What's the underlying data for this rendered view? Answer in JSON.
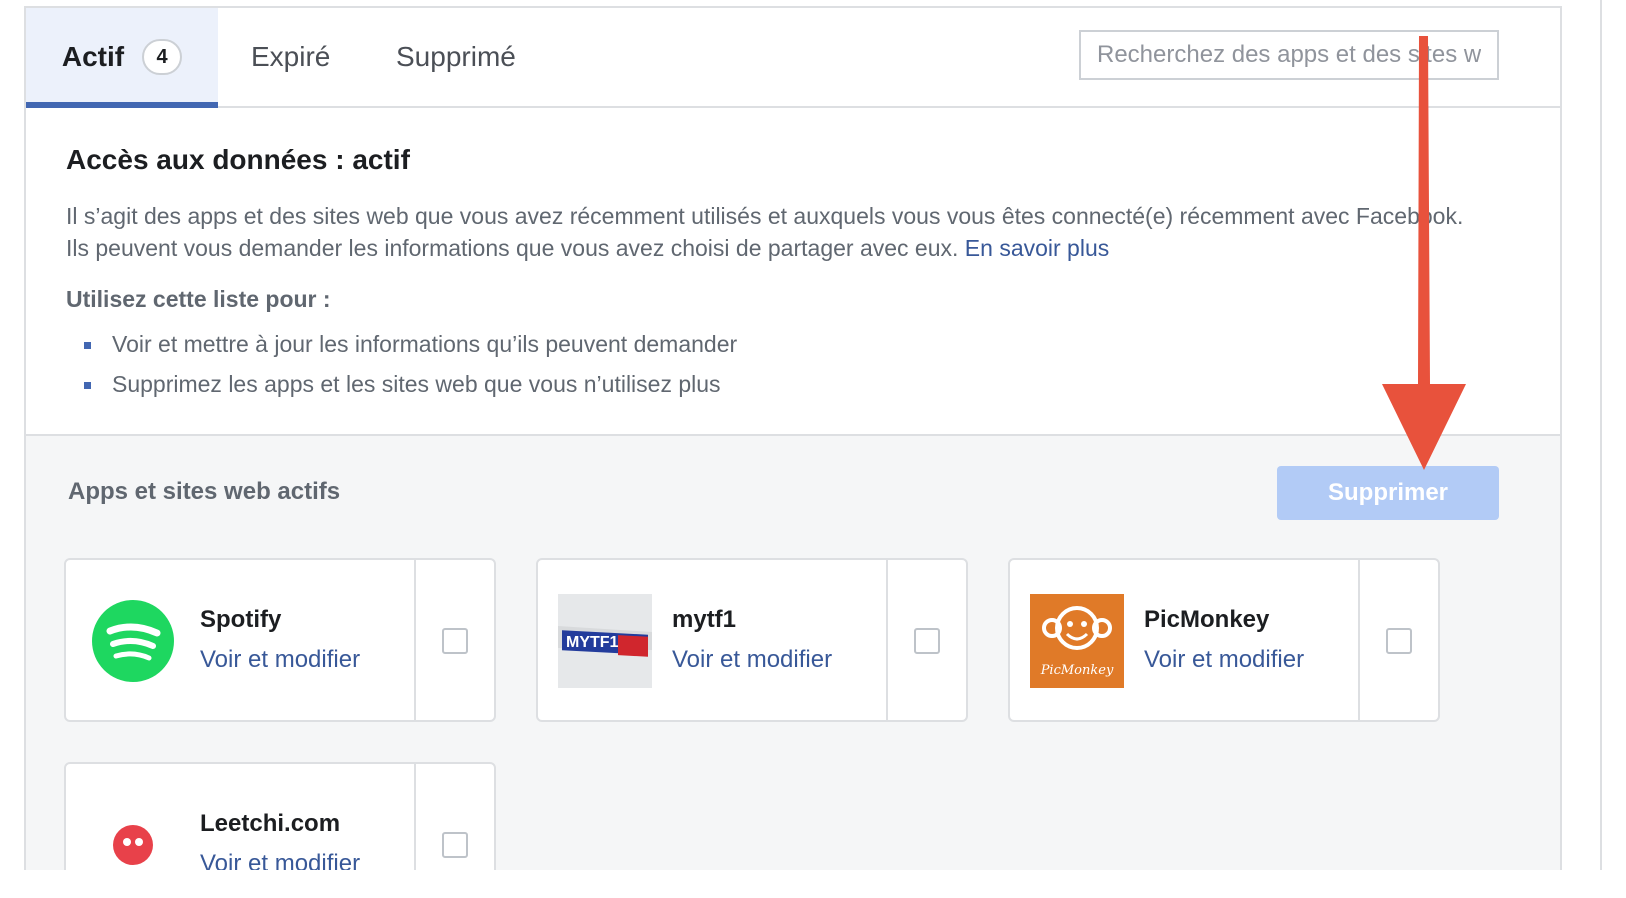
{
  "tabs": {
    "active": {
      "label": "Actif",
      "count": "4"
    },
    "expired": {
      "label": "Expiré"
    },
    "deleted": {
      "label": "Supprimé"
    }
  },
  "search": {
    "placeholder": "Recherchez des apps et des sites web"
  },
  "info": {
    "title": "Accès aux données : actif",
    "description": "Il s’agit des apps et des sites web que vous avez récemment utilisés et auxquels vous vous êtes connecté(e) récemment avec Facebook. Ils peuvent vous demander les informations que vous avez choisi de partager avec eux.",
    "learn_more": "En savoir plus",
    "subheading": "Utilisez cette liste pour :",
    "bullets": [
      "Voir et mettre à jour les informations qu’ils peuvent demander",
      "Supprimez les apps et les sites web que vous n’utilisez plus"
    ]
  },
  "section": {
    "title": "Apps et sites web actifs",
    "remove_label": "Supprimer"
  },
  "apps": [
    {
      "name": "Spotify",
      "link": "Voir et modifier",
      "icon": "spotify-logo"
    },
    {
      "name": "mytf1",
      "link": "Voir et modifier",
      "icon": "mytf1-logo",
      "logo_text": "MYTF1"
    },
    {
      "name": "PicMonkey",
      "link": "Voir et modifier",
      "icon": "picmonkey-logo",
      "logo_text": "PicMonkey"
    },
    {
      "name": "Leetchi.com",
      "link": "Voir et modifier",
      "icon": "leetchi-logo"
    }
  ],
  "colors": {
    "accent": "#4267b2",
    "link": "#385898",
    "button_disabled": "#b2cbf6",
    "spotify": "#1ed760",
    "picmonkey": "#e07a28",
    "arrow": "#e8523c"
  }
}
